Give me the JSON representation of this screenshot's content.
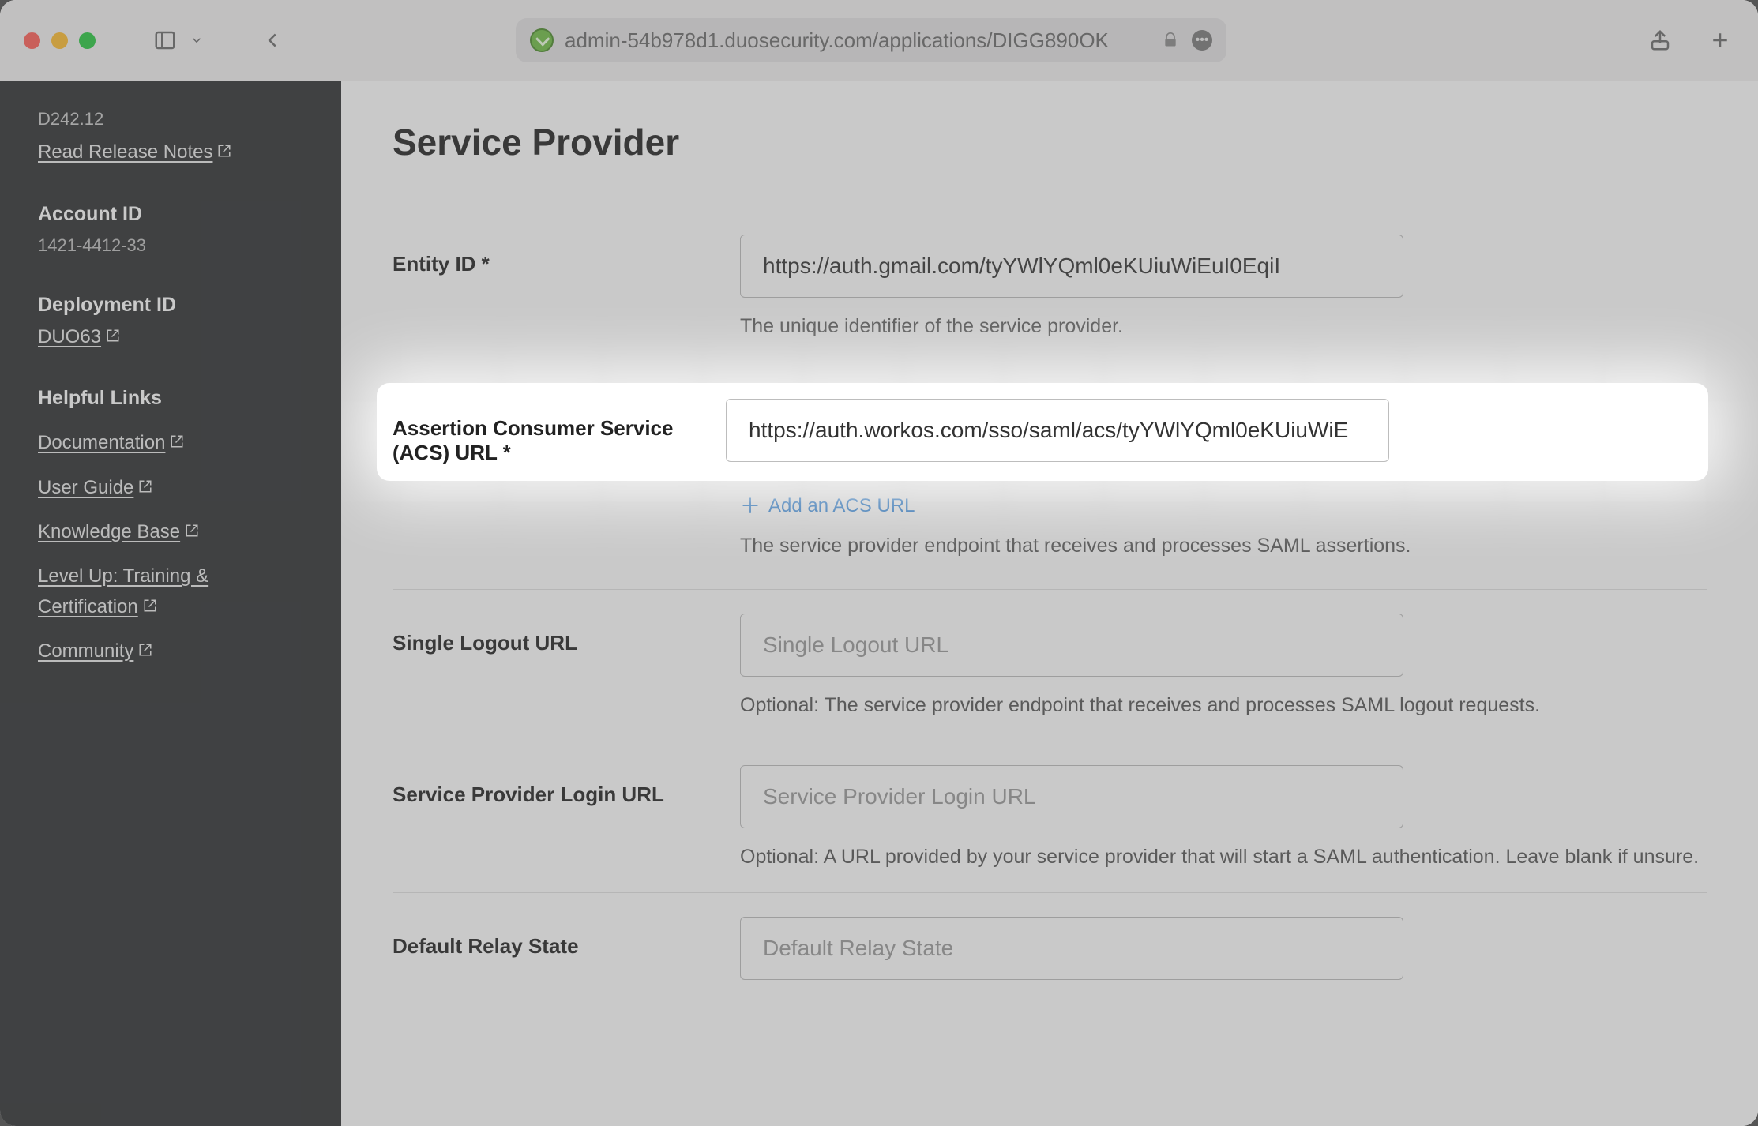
{
  "toolbar": {
    "url": "admin-54b978d1.duosecurity.com/applications/DIGG890OK"
  },
  "sidebar": {
    "version": "D242.12",
    "release_notes": "Read Release Notes",
    "account_id_label": "Account ID",
    "account_id_value": "1421-4412-33",
    "deployment_id_label": "Deployment ID",
    "deployment_id_value": "DUO63",
    "helpful_links_label": "Helpful Links",
    "links": {
      "documentation": "Documentation",
      "user_guide": "User Guide",
      "knowledge_base": "Knowledge Base",
      "training": "Level Up: Training & Certification",
      "community": "Community"
    }
  },
  "main": {
    "title": "Service Provider",
    "entity_id": {
      "label": "Entity ID *",
      "value": "https://auth.gmail.com/tyYWlYQml0eKUiuWiEuI0EqiI",
      "help": "The unique identifier of the service provider."
    },
    "acs": {
      "label": "Assertion Consumer Service (ACS) URL *",
      "value": "https://auth.workos.com/sso/saml/acs/tyYWlYQml0eKUiuWiE",
      "add_link": "Add an ACS URL",
      "help": "The service provider endpoint that receives and processes SAML assertions."
    },
    "slo": {
      "label": "Single Logout URL",
      "placeholder": "Single Logout URL",
      "help": "Optional: The service provider endpoint that receives and processes SAML logout requests."
    },
    "sp_login": {
      "label": "Service Provider Login URL",
      "placeholder": "Service Provider Login URL",
      "help": "Optional: A URL provided by your service provider that will start a SAML authentication. Leave blank if unsure."
    },
    "relay": {
      "label": "Default Relay State",
      "placeholder": "Default Relay State"
    }
  }
}
